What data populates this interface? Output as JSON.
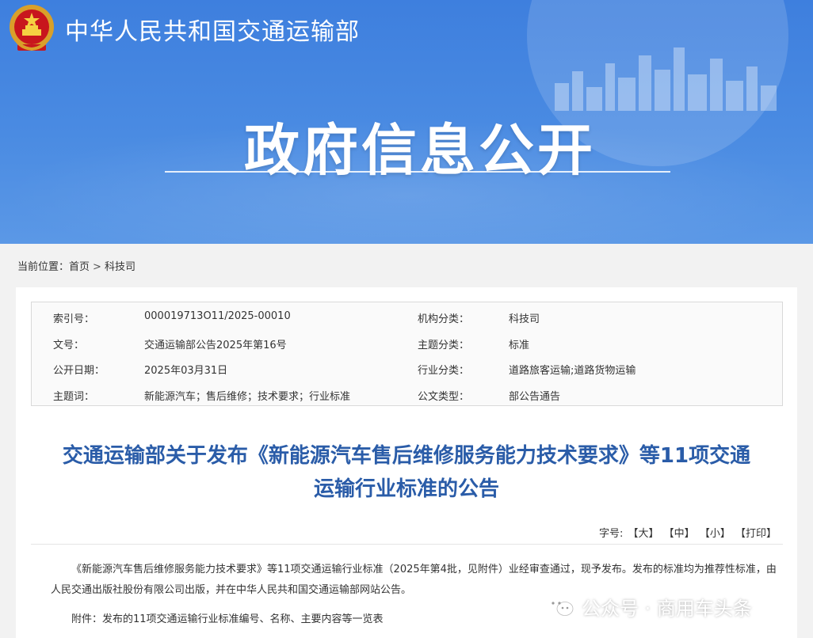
{
  "header": {
    "site_name": "中华人民共和国交通运输部",
    "banner_title": "政府信息公开",
    "emblem_icon": "national-emblem-icon"
  },
  "breadcrumb": {
    "label": "当前位置：",
    "home": "首页",
    "separator": ">",
    "current": "科技司"
  },
  "meta": {
    "rows": [
      {
        "k1": "索引号：",
        "v1": "000019713O11/2025-00010",
        "k2": "机构分类：",
        "v2": "科技司"
      },
      {
        "k1": "文号：",
        "v1": "交通运输部公告2025年第16号",
        "k2": "主题分类：",
        "v2": "标准"
      },
      {
        "k1": "公开日期：",
        "v1": "2025年03月31日",
        "k2": "行业分类：",
        "v2": "道路旅客运输;道路货物运输"
      },
      {
        "k1": "主题词：",
        "v1": "新能源汽车；售后维修；技术要求；行业标准",
        "k2": "公文类型：",
        "v2": "部公告通告"
      }
    ]
  },
  "article": {
    "title_line1": "交通运输部关于发布《新能源汽车售后维修服务能力技术要求》等11项交通",
    "title_line2": "运输行业标准的公告",
    "font_label": "字号:",
    "font_large": "【大】",
    "font_medium": "【中】",
    "font_small": "【小】",
    "print": "【打印】",
    "paragraph": "《新能源汽车售后维修服务能力技术要求》等11项交通运输行业标准（2025年第4批，见附件）业经审查通过，现予发布。发布的标准均为推荐性标准，由人民交通出版社股份有限公司出版，并在中华人民共和国交通运输部网站公告。",
    "attachment": "附件：发布的11项交通运输行业标准编号、名称、主要内容等一览表"
  },
  "watermark": {
    "icon": "wechat-icon",
    "text": "公众号 · 商用车头条"
  },
  "colors": {
    "banner": "#4a8be2",
    "title": "#2a5ca8"
  }
}
